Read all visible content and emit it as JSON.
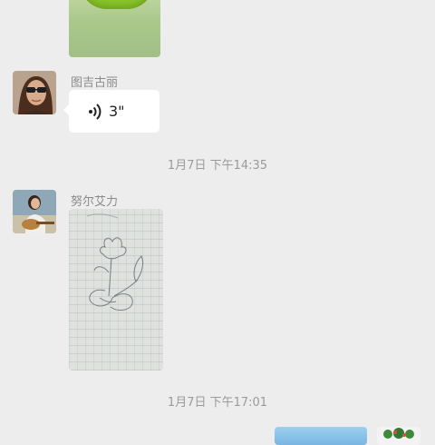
{
  "messages": [
    {
      "type": "image",
      "description": "green image (partially visible)"
    },
    {
      "type": "voice",
      "sender": "图吉古丽",
      "duration": "3\""
    },
    {
      "type": "timestamp",
      "text": "1月7日 下午14:35"
    },
    {
      "type": "image",
      "sender": "努尔艾力",
      "description": "pencil sketch of a flower on grid paper"
    },
    {
      "type": "timestamp",
      "text": "1月7日 下午17:01"
    }
  ],
  "colors": {
    "background": "#ededed",
    "bubble": "#ffffff",
    "meta_text": "#9a9a9a"
  }
}
